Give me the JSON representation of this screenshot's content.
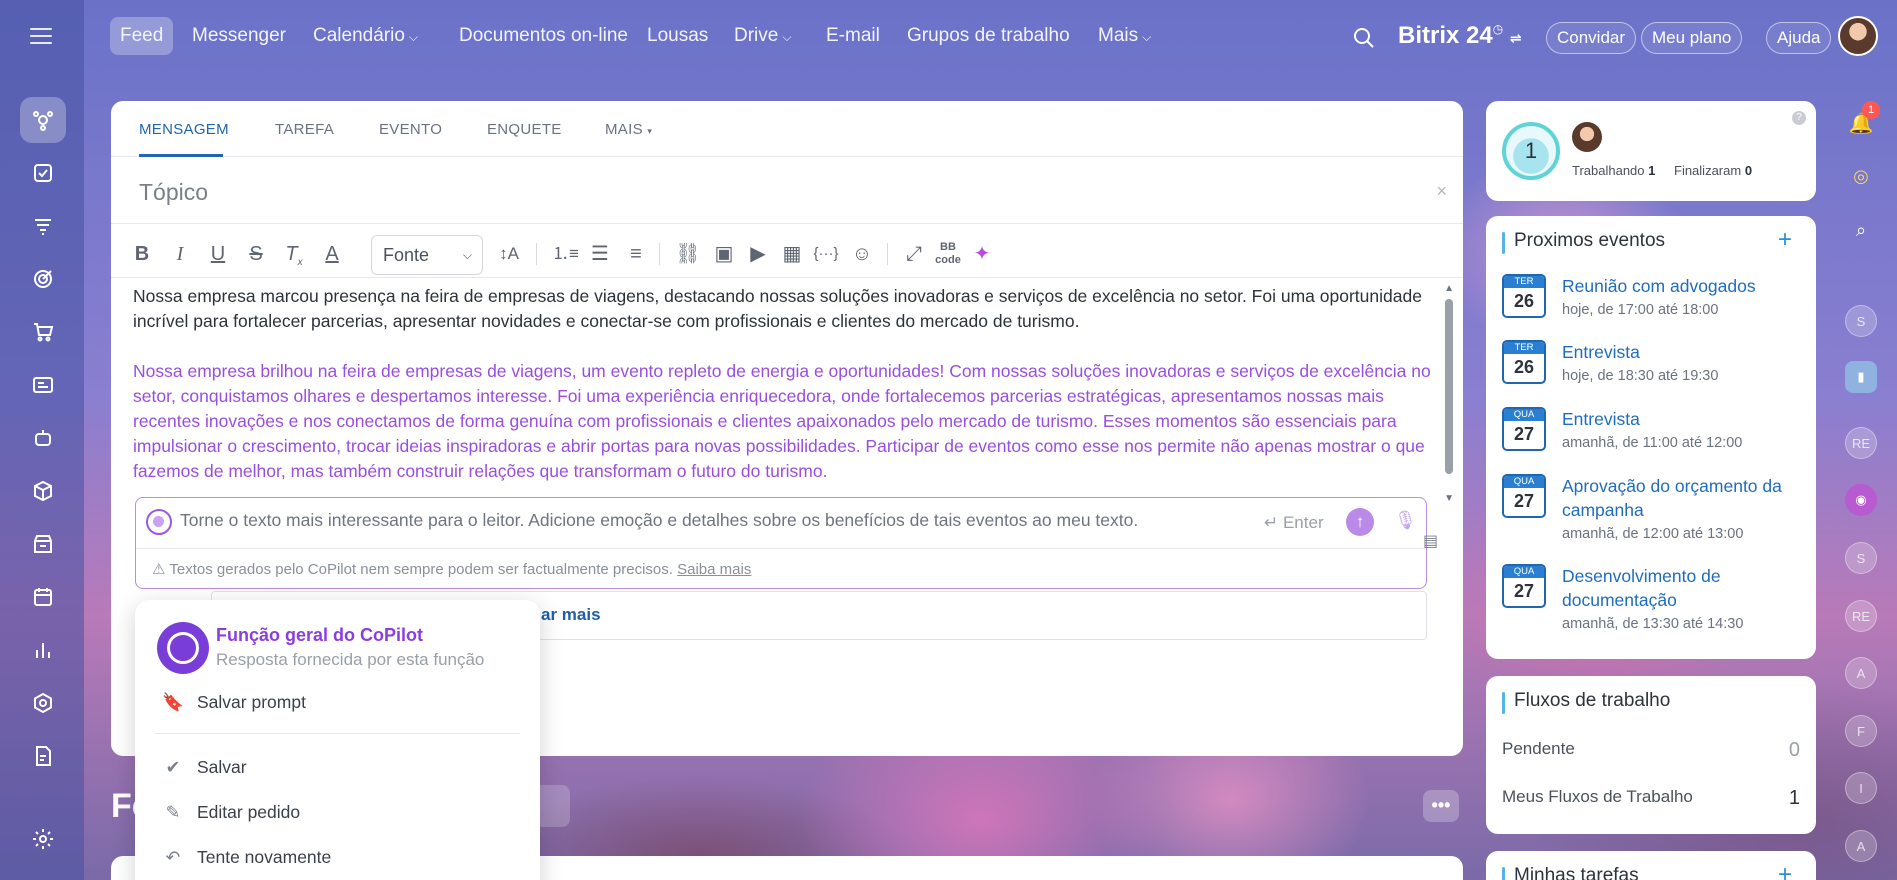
{
  "nav": {
    "items": [
      {
        "label": "Feed",
        "active": true
      },
      {
        "label": "Messenger"
      },
      {
        "label": "Calendário",
        "dropdown": true
      },
      {
        "label": "Documentos on-line"
      },
      {
        "label": "Lousas"
      },
      {
        "label": "Drive",
        "dropdown": true
      },
      {
        "label": "E-mail"
      },
      {
        "label": "Grupos de trabalho"
      },
      {
        "label": "Mais",
        "dropdown": true
      }
    ],
    "brand": "Bitrix 24",
    "invite": "Convidar",
    "my_plan": "Meu plano",
    "help": "Ajuda"
  },
  "composer": {
    "tabs": [
      "MENSAGEM",
      "TAREFA",
      "EVENTO",
      "ENQUETE",
      "MAIS"
    ],
    "topic_placeholder": "Tópico",
    "font_select": "Fonte",
    "paragraph1": "Nossa empresa marcou presença na feira de empresas de viagens, destacando nossas soluções inovadoras e serviços de excelência no setor. Foi uma oportunidade incrível para fortalecer parcerias, apresentar novidades e conectar-se com profissionais e clientes do mercado de turismo.",
    "paragraph2": "Nossa empresa brilhou na feira de empresas de viagens, um evento repleto de energia e oportunidades! Com nossas soluções inovadoras e serviços de excelência no setor, conquistamos olhares e despertamos interesse. Foi uma experiência enriquecedora, onde fortalecemos parcerias estratégicas, apresentamos nossas mais recentes inovações e nos conectamos de forma genuína com profissionais e clientes apaixonados pelo mercado de turismo. Esses momentos são essenciais para impulsionar o crescimento, trocar ideias inspiradoras e abrir portas para novas possibilidades. Participar de eventos como esse nos permite não apenas mostrar o que fazemos de melhor, mas também construir relações que transformam o futuro do turismo.",
    "copilot_prompt": "Torne o texto mais interessante para o leitor. Adicione emoção e detalhes sobre os benefícios de tais eventos ao meu texto.",
    "enter_hint": "Enter",
    "disclaimer": "Textos gerados pelo CoPilot nem sempre podem ser factualmente precisos.",
    "disclaimer_link": "Saiba mais",
    "more_label": "ar mais"
  },
  "popup": {
    "title": "Função geral do CoPilot",
    "subtitle": "Resposta fornecida por esta função",
    "save_prompt": "Salvar prompt",
    "save": "Salvar",
    "edit": "Editar pedido",
    "retry": "Tente novamente"
  },
  "feed_label": "Fe",
  "work": {
    "count": "1",
    "working_label": "Trabalhando",
    "working_value": "1",
    "finished_label": "Finalizaram",
    "finished_value": "0"
  },
  "events": {
    "title": "Proximos eventos",
    "items": [
      {
        "dow": "TER",
        "day": "26",
        "title": "Reunião com advogados",
        "time": "hoje, de 17:00 até 18:00"
      },
      {
        "dow": "TER",
        "day": "26",
        "title": "Entrevista",
        "time": "hoje, de 18:30 até 19:30"
      },
      {
        "dow": "QUA",
        "day": "27",
        "title": "Entrevista",
        "time": "amanhã, de 11:00 até 12:00"
      },
      {
        "dow": "QUA",
        "day": "27",
        "title": "Aprovação do orçamento da campanha",
        "time": "amanhã, de 12:00 até 13:00"
      },
      {
        "dow": "QUA",
        "day": "27",
        "title": "Desenvolvimento de documentação",
        "time": "amanhã, de 13:30 até 14:30"
      }
    ]
  },
  "flows": {
    "title": "Fluxos de trabalho",
    "pending_label": "Pendente",
    "pending_value": "0",
    "mine_label": "Meus Fluxos de Trabalho",
    "mine_value": "1"
  },
  "tasks": {
    "title": "Minhas tarefas"
  },
  "notifications": {
    "count": "1"
  },
  "right_rail_initials": [
    "S",
    "RE",
    "S",
    "RE",
    "A",
    "F",
    "I",
    "A"
  ]
}
